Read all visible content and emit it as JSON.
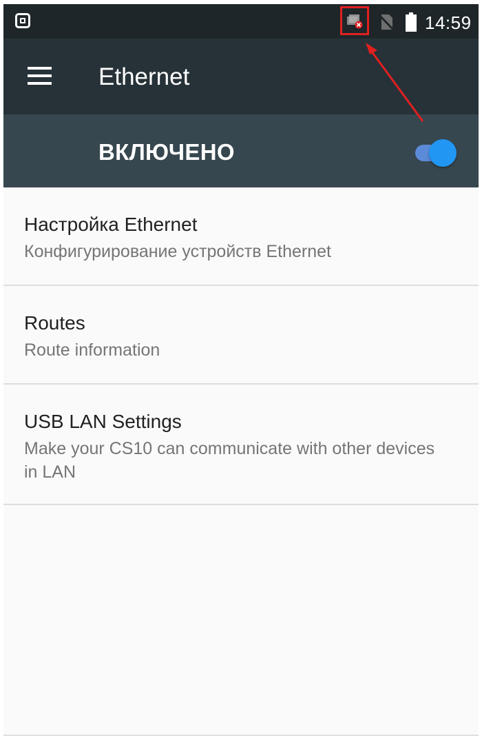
{
  "status_bar": {
    "time": "14:59",
    "icons": [
      "screenshot-icon",
      "ethernet-disconnected-icon",
      "no-sim-icon",
      "battery-icon"
    ]
  },
  "toolbar": {
    "title": "Ethernet",
    "menu_icon": "hamburger-menu-icon"
  },
  "switch_bar": {
    "label": "ВКЛЮЧЕНО",
    "enabled": true
  },
  "settings_list": [
    {
      "title": "Настройка Ethernet",
      "summary": "Конфигурирование устройств Ethernet"
    },
    {
      "title": "Routes",
      "summary": "Route information"
    },
    {
      "title": "USB LAN Settings",
      "summary": "Make your CS10 can communicate with other devices in LAN"
    }
  ],
  "colors": {
    "status_bar": "#1f262a",
    "toolbar": "#263238",
    "switch_bar": "#37474f",
    "accent": "#2196f3",
    "annotation": "#e02020",
    "background": "#fafafa"
  }
}
